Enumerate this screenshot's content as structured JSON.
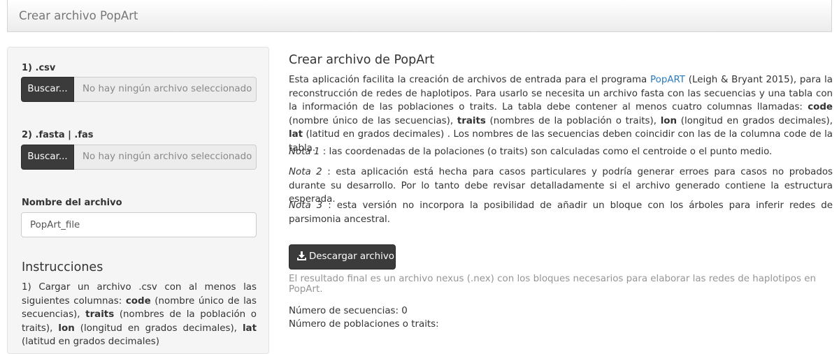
{
  "navbar": {
    "title": "Crear archivo PopArt"
  },
  "sidebar": {
    "csv": {
      "label": "1) .csv",
      "button": "Buscar...",
      "status": "No hay ningún archivo seleccionado"
    },
    "fasta": {
      "label": "2) .fasta | .fas",
      "button": "Buscar...",
      "status": "No hay ningún archivo seleccionado"
    },
    "filename": {
      "label": "Nombre del archivo",
      "value": "PopArt_file"
    },
    "instructions": {
      "title": "Instrucciones",
      "p1_a": "1) Cargar un archivo .csv con al menos las siguientes columnas: ",
      "code": "code",
      "p1_b": " (nombre único de las secuencias), ",
      "traits": "traits",
      "p1_c": " (nombres de la población o traits), ",
      "lon": "lon",
      "p1_d": " (longitud en grados decimales), ",
      "lat": "lat",
      "p1_e": " (latitud en grados decimales)"
    }
  },
  "main": {
    "title": "Crear archivo de PopArt",
    "intro": {
      "a": "Esta aplicación facilita la creación de archivos de entrada para el programa ",
      "link": "PopART",
      "b": " (Leigh & Bryant 2015), para la reconstrucción de redes de haplotipos. Para usarlo se necesita un archivo fasta con las secuencias y una tabla con la información de las poblaciones o traits. La tabla debe contener al menos cuatro columnas llamadas: ",
      "code": "code",
      "c": " (nombre único de las secuencias), ",
      "traits": "traits",
      "d": " (nombres de la población o traits), ",
      "lon": "lon",
      "e": " (longitud en grados decimales), ",
      "lat": "lat",
      "f": " (latitud en grados decimales) . Los nombres de las secuencias deben coincidir con las de la columna code de la tabla."
    },
    "note1": {
      "label": "Nota 1",
      "text": " : las coordenadas de la polaciones (o traits) son calculadas como el centroide o el punto medio."
    },
    "note2": {
      "label": "Nota 2",
      "text": " : esta aplicación está hecha para casos particulares y podría generar erroes para casos no probados durante su desarrollo. Por lo tanto debe revisar detalladamente si el archivo generado contiene la estructura esperada."
    },
    "note3": {
      "label": "Nota 3",
      "text": " : esta versión no incorpora la posibilidad de añadir un bloque con los árboles para inferir redes de parsimonia ancestral."
    },
    "download_button": "Descargar archivo",
    "help": "El resultado final es un archivo nexus (.nex) con los bloques necesarios para elaborar las redes de haplotipos en PopArt.",
    "seq_count": "Número de secuencias: 0",
    "pop_count": "Número de poblaciones o traits:"
  },
  "icons": {
    "download": "download-icon"
  }
}
